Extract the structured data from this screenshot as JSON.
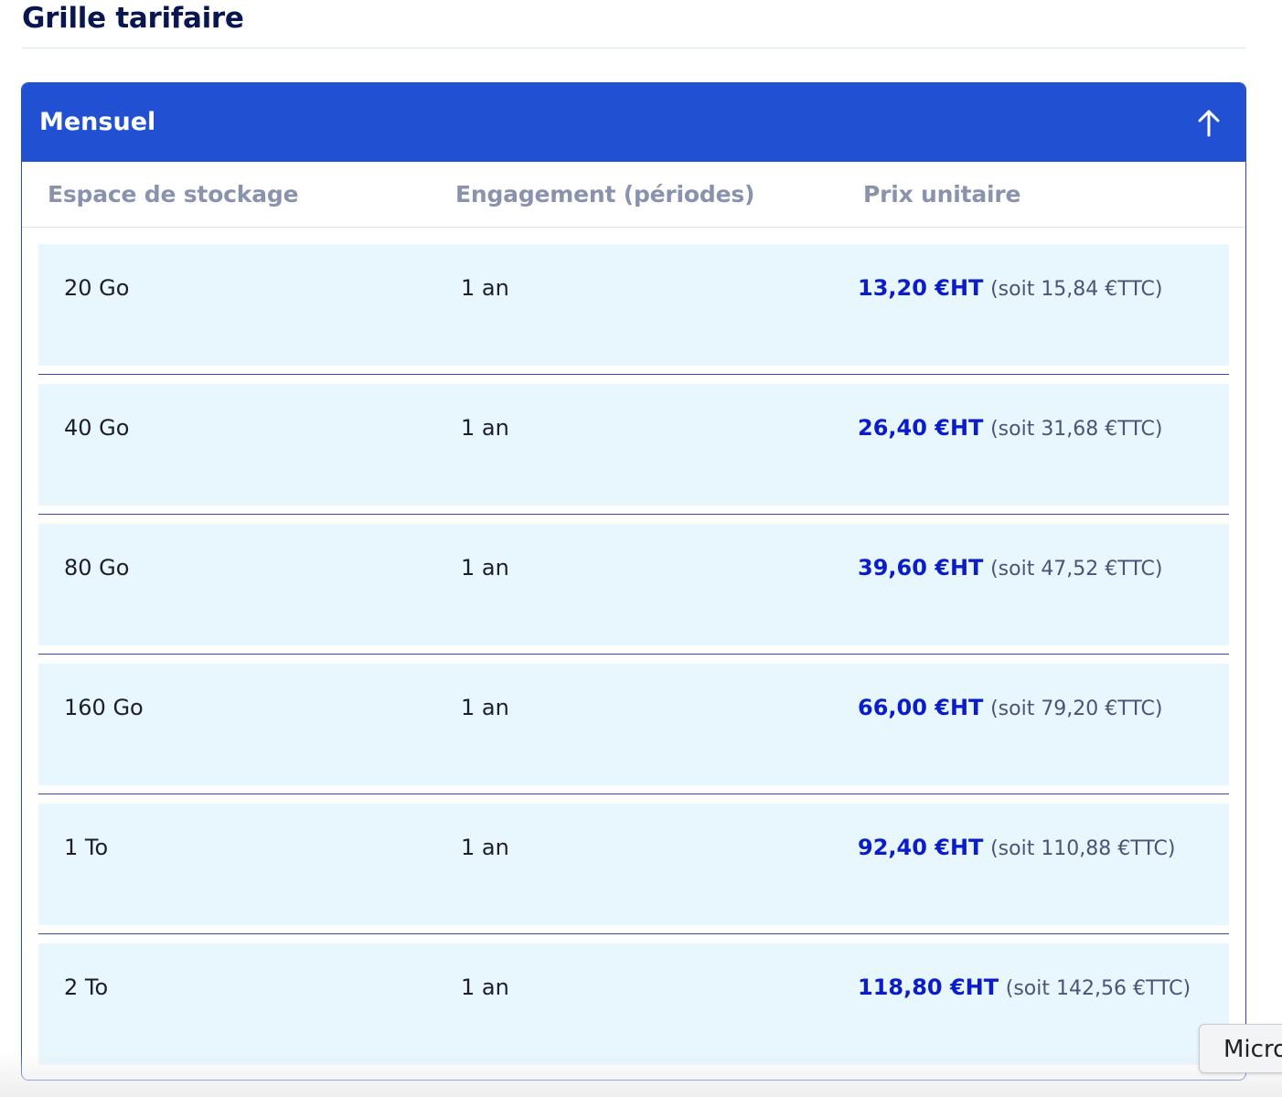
{
  "page": {
    "title": "Grille tarifaire"
  },
  "panel": {
    "title": "Mensuel",
    "toggle_icon": "arrow-up-icon",
    "header_color": "#2150d3"
  },
  "table": {
    "headers": [
      "Espace de stockage",
      "Engagement (périodes)",
      "Prix unitaire"
    ],
    "rows": [
      {
        "storage": "20 Go",
        "commitment": "1 an",
        "price_ht": "13,20 €HT",
        "price_ttc": "(soit 15,84 €TTC)"
      },
      {
        "storage": "40 Go",
        "commitment": "1 an",
        "price_ht": "26,40 €HT",
        "price_ttc": "(soit 31,68 €TTC)"
      },
      {
        "storage": "80 Go",
        "commitment": "1 an",
        "price_ht": "39,60 €HT",
        "price_ttc": "(soit 47,52 €TTC)"
      },
      {
        "storage": "160 Go",
        "commitment": "1 an",
        "price_ht": "66,00 €HT",
        "price_ttc": "(soit 79,20 €TTC)"
      },
      {
        "storage": "1 To",
        "commitment": "1 an",
        "price_ht": "92,40 €HT",
        "price_ttc": "(soit 110,88 €TTC)"
      },
      {
        "storage": "2 To",
        "commitment": "1 an",
        "price_ht": "118,80 €HT",
        "price_ttc": "(soit 142,56 €TTC)"
      }
    ]
  },
  "overlay": {
    "label": "Micro"
  }
}
